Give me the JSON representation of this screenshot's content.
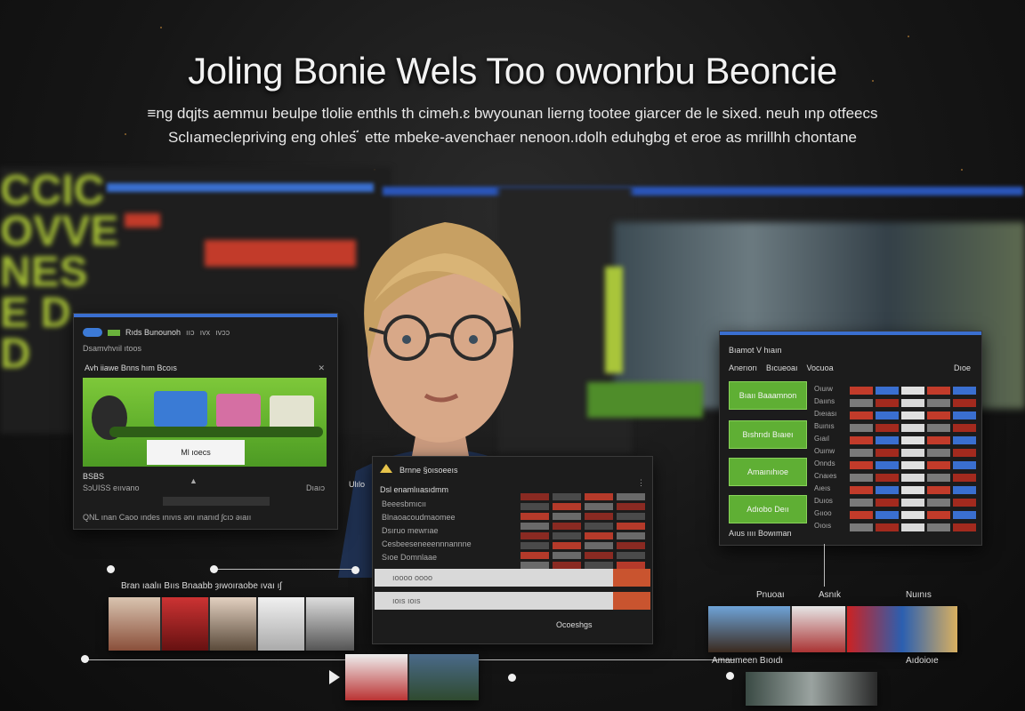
{
  "headline": "Joling Bonie Wels Too owonrbu Beoncie",
  "subline_1": "≡ng dqjts aemmuı beulpe tlolie enthls th cimeh.ɛ bwyounan lierng tootee giarcer de le sixed. neuh ınp otfeecs",
  "subline_2": "Sclıameclepriving eng ohles ፟ ette mbeke-avenchaer nenoon.ıdolh eduhgbg et eroe as mrillhh chontane",
  "left_panel": {
    "brand": "Rıds Bunounoh",
    "sub": "Dsamvhvıil ıtoos",
    "menu": [
      "ııɔ",
      "ıvx",
      "ıvɔɔ"
    ],
    "section": "Avh iiawe  Bnns  hım  Bcoıs",
    "card": "Ml ıoecs",
    "caption": "BSBS",
    "meta": "SɔUISS eııvano",
    "footer": "QNL  ınan  Caoo  ındes  ınıvıs  ǝnı ınanıd  ʃcıɔ  ǝıaıı",
    "badge": "Dıaıɔ"
  },
  "center_panel": {
    "title": "Brnne §oısoeeıs",
    "heading": "Dsl enamlııasıdmm",
    "items": [
      "Beeesbmıcıı",
      "Blnaoacoudmaomee",
      "Dsıruo mewrıae",
      "Cesbeeseneeennnannne",
      "Sıoe Domnlaae"
    ],
    "button_1": "ıoooo oooo",
    "button_2": "ıoıs ıoıs",
    "footer": "Ocoeshgs"
  },
  "right_panel": {
    "title": "Bıamot V hıaın",
    "tabs": [
      "Anerıorı",
      "Bıcueoaı",
      "Vocuoa",
      "Dıoe"
    ],
    "buttons": [
      "Bıaıı Baaamnon",
      "Bıshrıdı Bıaıeı",
      "Amaınıhıoe",
      "Adıobo Deıı"
    ],
    "footer": "Aıus  ıııı Bowıman",
    "row_labels": [
      "Oıuıw",
      "Daııns",
      "Dıeıası",
      "Buınıs",
      "Gıaıl",
      "Ouınw",
      "Onnds",
      "Cnaıes",
      "Aıeıs",
      "Duıos",
      "Gııoo",
      "Oıoıs"
    ]
  },
  "timeline": {
    "label_left": "Bran ıaalıı  Bııs Bnaabb  ȝıwoıraobe  ıvaı ıʃ",
    "label_a": "Pnuoaı",
    "label_b": "Asnık",
    "label_c": "Nuınıs",
    "label_d": "Amaumeen Bıoıdı",
    "label_e": "Aıdoioıe",
    "tag": "Ulılo"
  },
  "colors": {
    "accent_blue": "#3a6fd0",
    "accent_green": "#5faf34",
    "accent_orange": "#c9542f",
    "accent_red": "#c23b2a"
  }
}
